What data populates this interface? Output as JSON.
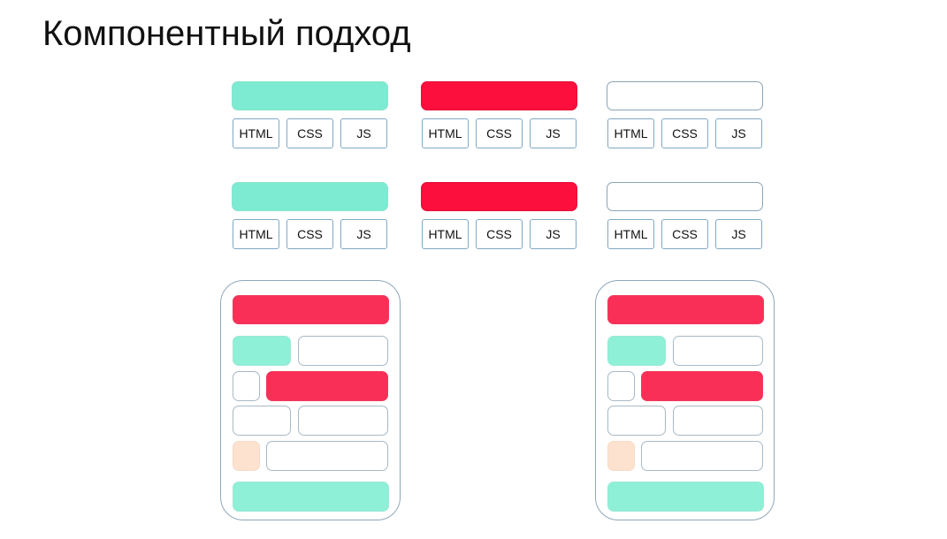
{
  "title": "Компонентный подход",
  "chip_labels": [
    "HTML",
    "CSS",
    "JS"
  ],
  "colors": {
    "teal": "#7cebd2",
    "red": "#fc0f3c",
    "page_red": "#fa2f58",
    "page_teal": "#8ef0d7",
    "peach": "#fde3cf",
    "border": "#7fa8c4"
  },
  "components": [
    {
      "row": 1,
      "col": 1,
      "color": "teal"
    },
    {
      "row": 1,
      "col": 2,
      "color": "red"
    },
    {
      "row": 1,
      "col": 3,
      "color": "white"
    },
    {
      "row": 2,
      "col": 1,
      "color": "teal"
    },
    {
      "row": 2,
      "col": 2,
      "color": "red"
    },
    {
      "row": 2,
      "col": 3,
      "color": "white"
    }
  ],
  "page_mockups": [
    {
      "side": "left"
    },
    {
      "side": "right"
    }
  ]
}
